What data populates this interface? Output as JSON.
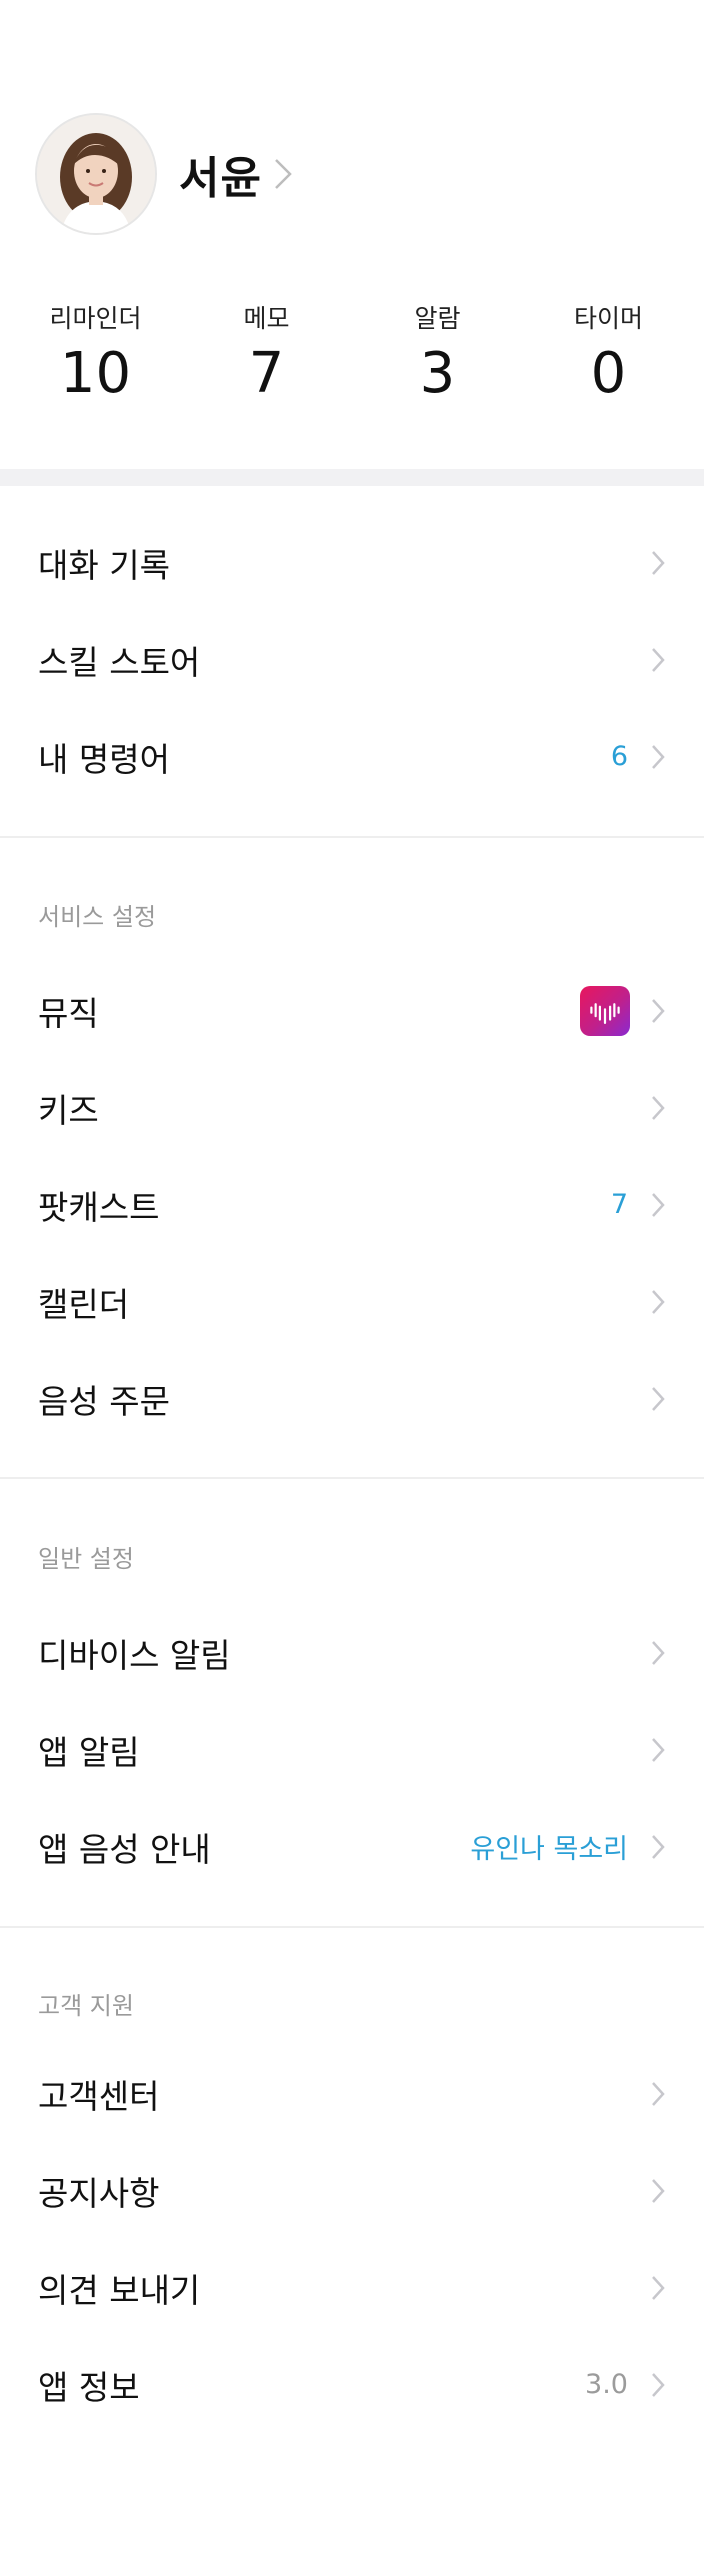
{
  "profile": {
    "name": "서윤"
  },
  "stats": [
    {
      "label": "리마인더",
      "value": "10"
    },
    {
      "label": "메모",
      "value": "7"
    },
    {
      "label": "알람",
      "value": "3"
    },
    {
      "label": "타이머",
      "value": "0"
    }
  ],
  "menu_top": [
    {
      "label": "대화 기록",
      "value": ""
    },
    {
      "label": "스킬 스토어",
      "value": ""
    },
    {
      "label": "내 명령어",
      "value": "6"
    }
  ],
  "service_settings": {
    "title": "서비스 설정",
    "items": [
      {
        "label": "뮤직",
        "icon": "music-app-icon"
      },
      {
        "label": "키즈",
        "value": ""
      },
      {
        "label": "팟캐스트",
        "value": "7"
      },
      {
        "label": "캘린더",
        "value": ""
      },
      {
        "label": "음성 주문",
        "value": ""
      }
    ]
  },
  "general_settings": {
    "title": "일반 설정",
    "items": [
      {
        "label": "디바이스 알림",
        "value": ""
      },
      {
        "label": "앱 알림",
        "value": ""
      },
      {
        "label": "앱 음성 안내",
        "value": "유인나 목소리"
      }
    ]
  },
  "support": {
    "title": "고객 지원",
    "items": [
      {
        "label": "고객센터",
        "value": ""
      },
      {
        "label": "공지사항",
        "value": ""
      },
      {
        "label": "의견 보내기",
        "value": ""
      },
      {
        "label": "앱 정보",
        "value": "3.0"
      }
    ]
  },
  "colors": {
    "accent": "#2a9fd6",
    "chevron": "#c7c7cc",
    "section_gap": "#f1f1f3"
  }
}
